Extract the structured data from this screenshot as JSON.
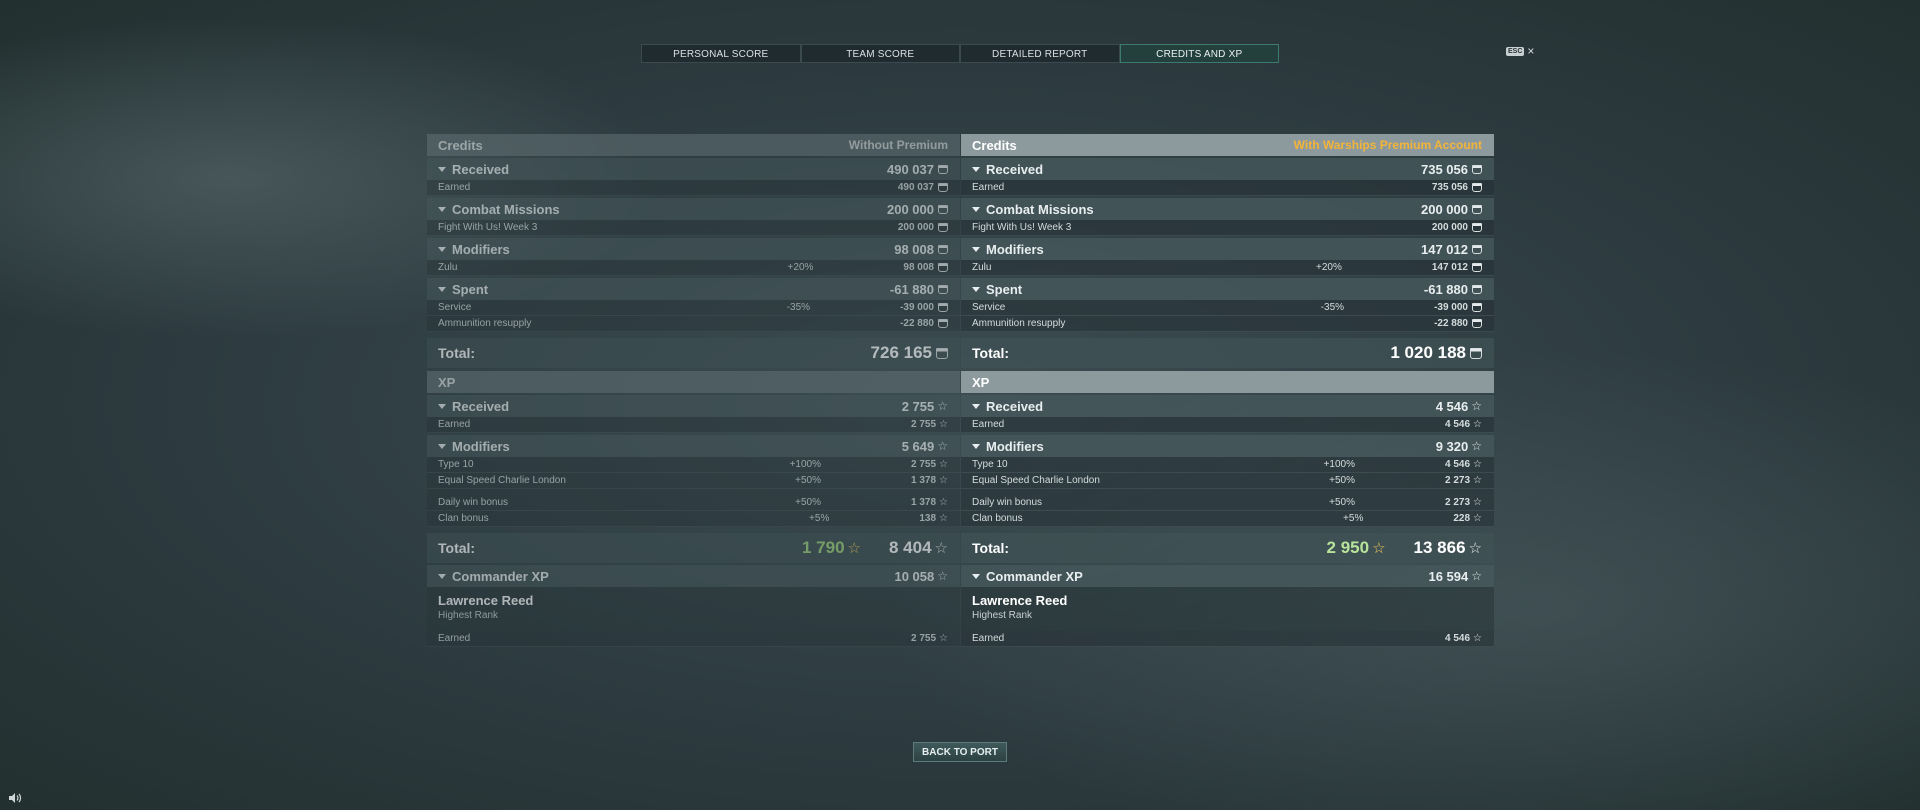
{
  "tabs": [
    {
      "label": "PERSONAL SCORE"
    },
    {
      "label": "TEAM SCORE"
    },
    {
      "label": "DETAILED REPORT"
    },
    {
      "label": "CREDITS AND XP",
      "active": true
    }
  ],
  "esc": {
    "key": "ESC",
    "close": "×"
  },
  "columns": {
    "left": {
      "credits_title": "Credits",
      "account_label": "Without Premium",
      "received": {
        "label": "Received",
        "value": "490 037",
        "earned_label": "Earned",
        "earned_value": "490 037"
      },
      "combat": {
        "label": "Combat Missions",
        "value": "200 000",
        "item_label": "Fight With Us! Week 3",
        "item_value": "200 000"
      },
      "modifiers": {
        "label": "Modifiers",
        "value": "98 008",
        "item_label": "Zulu",
        "item_pct": "+20%",
        "item_value": "98 008"
      },
      "spent": {
        "label": "Spent",
        "value": "-61 880",
        "service_label": "Service",
        "service_pct": "-35%",
        "service_value": "-39 000",
        "ammo_label": "Ammunition resupply",
        "ammo_value": "-22 880"
      },
      "credits_total": {
        "label": "Total:",
        "value": "726 165"
      },
      "xp_title": "XP",
      "xp_received": {
        "label": "Received",
        "value": "2 755",
        "earned_label": "Earned",
        "earned_value": "2 755"
      },
      "xp_modifiers": {
        "label": "Modifiers",
        "value": "5 649",
        "items": [
          {
            "label": "Type 10",
            "pct": "+100%",
            "value": "2 755"
          },
          {
            "label": "Equal Speed Charlie London",
            "pct": "+50%",
            "value": "1 378"
          },
          {
            "label": "Daily win bonus",
            "pct": "+50%",
            "value": "1 378"
          },
          {
            "label": "Clan bonus",
            "pct": "+5%",
            "value": "138"
          }
        ]
      },
      "xp_total": {
        "label": "Total:",
        "free": "1 790",
        "value": "8 404"
      },
      "commander": {
        "label": "Commander XP",
        "value": "10 058",
        "name": "Lawrence Reed",
        "rank": "Highest Rank",
        "earned_label": "Earned",
        "earned_value": "2 755"
      }
    },
    "right": {
      "credits_title": "Credits",
      "account_label": "With Warships Premium Account",
      "received": {
        "label": "Received",
        "value": "735 056",
        "earned_label": "Earned",
        "earned_value": "735 056"
      },
      "combat": {
        "label": "Combat Missions",
        "value": "200 000",
        "item_label": "Fight With Us! Week 3",
        "item_value": "200 000"
      },
      "modifiers": {
        "label": "Modifiers",
        "value": "147 012",
        "item_label": "Zulu",
        "item_pct": "+20%",
        "item_value": "147 012"
      },
      "spent": {
        "label": "Spent",
        "value": "-61 880",
        "service_label": "Service",
        "service_pct": "-35%",
        "service_value": "-39 000",
        "ammo_label": "Ammunition resupply",
        "ammo_value": "-22 880"
      },
      "credits_total": {
        "label": "Total:",
        "value": "1 020 188"
      },
      "xp_title": "XP",
      "xp_received": {
        "label": "Received",
        "value": "4 546",
        "earned_label": "Earned",
        "earned_value": "4 546"
      },
      "xp_modifiers": {
        "label": "Modifiers",
        "value": "9 320",
        "items": [
          {
            "label": "Type 10",
            "pct": "+100%",
            "value": "4 546"
          },
          {
            "label": "Equal Speed Charlie London",
            "pct": "+50%",
            "value": "2 273"
          },
          {
            "label": "Daily win bonus",
            "pct": "+50%",
            "value": "2 273"
          },
          {
            "label": "Clan bonus",
            "pct": "+5%",
            "value": "228"
          }
        ]
      },
      "xp_total": {
        "label": "Total:",
        "free": "2 950",
        "value": "13 866"
      },
      "commander": {
        "label": "Commander XP",
        "value": "16 594",
        "name": "Lawrence Reed",
        "rank": "Highest Rank",
        "earned_label": "Earned",
        "earned_value": "4 546"
      }
    }
  },
  "back_button": {
    "label": "BACK TO PORT"
  },
  "icons": {
    "credits": "credits-coin-icon",
    "xp": "xp-star-icon",
    "sound": "speaker-icon"
  },
  "colors": {
    "premium_accent": "#f3b43a",
    "free_xp": "#b8e39b",
    "active_tab": "#23403d"
  }
}
